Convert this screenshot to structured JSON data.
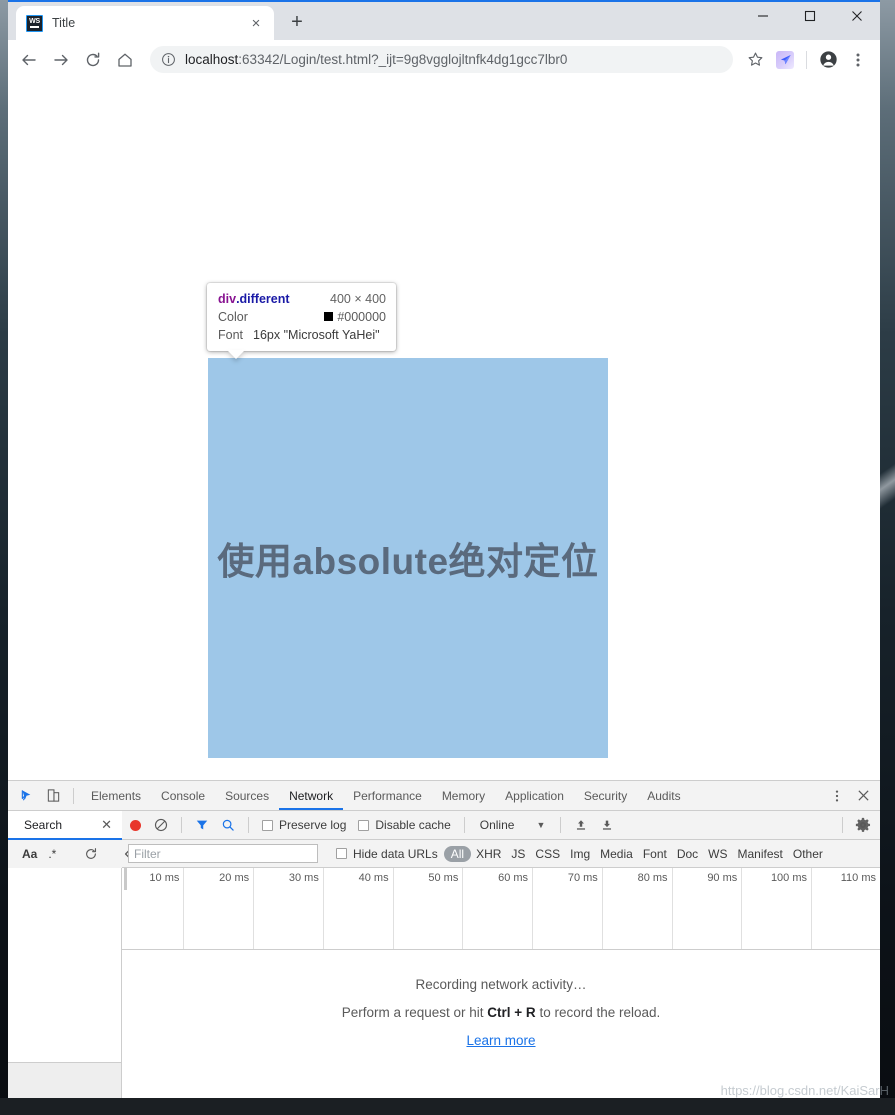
{
  "browser": {
    "tab": {
      "title": "Title",
      "favicon": "webstorm-icon",
      "close_label": "×"
    },
    "new_tab_label": "+",
    "window_controls": {
      "minimize": "minimize-icon",
      "maximize": "maximize-icon",
      "close": "close-icon"
    },
    "nav": {
      "back": "back-arrow-icon",
      "forward": "forward-arrow-icon",
      "reload": "reload-icon",
      "home": "home-icon"
    },
    "omnibox": {
      "info_icon": "info-circle-icon",
      "url_host": "localhost",
      "url_rest": ":63342/Login/test.html?_ijt=9g8vgglojltnfk4dg1gcc7lbr0",
      "url_full": "localhost:63342/Login/test.html?_ijt=9g8vgglojltnfk4dg1gcc7lbr0"
    },
    "actions": {
      "bookmark": "star-icon",
      "extension": "extension-icon",
      "profile": "account-avatar-icon",
      "menu": "three-dot-menu-icon"
    }
  },
  "page": {
    "box_text": "使用absolute绝对定位",
    "box_color": "#9ec7e8",
    "box_text_color": "#5a6a7d"
  },
  "inspect_tooltip": {
    "selector_tag": "div",
    "selector_class": ".different",
    "dimensions": "400 × 400",
    "rows": [
      {
        "label": "Color",
        "value": "#000000",
        "swatch": "#000000"
      },
      {
        "label": "Font",
        "value": "16px \"Microsoft YaHei\""
      }
    ]
  },
  "devtools": {
    "inspect_icon": "inspect-element-icon",
    "device_icon": "device-toolbar-icon",
    "tabs": [
      {
        "label": "Elements",
        "selected": false
      },
      {
        "label": "Console",
        "selected": false
      },
      {
        "label": "Sources",
        "selected": false
      },
      {
        "label": "Network",
        "selected": true
      },
      {
        "label": "Performance",
        "selected": false
      },
      {
        "label": "Memory",
        "selected": false
      },
      {
        "label": "Application",
        "selected": false
      },
      {
        "label": "Security",
        "selected": false
      },
      {
        "label": "Audits",
        "selected": false
      }
    ],
    "more_icon": "three-dot-menu-icon",
    "close_icon": "close-icon",
    "search_panel": {
      "tab_label": "Search",
      "close_label": "✕",
      "match_case": "Aa",
      "regex": ".*",
      "refresh": "refresh-icon",
      "collapse": "chevron-left-icon"
    },
    "network_toolbar": {
      "record_icon": "record-red-dot-icon",
      "clear_icon": "clear-no-entry-icon",
      "filter_icon": "filter-funnel-icon",
      "search_icon": "magnifier-icon",
      "preserve_log_label": "Preserve log",
      "preserve_log_checked": false,
      "disable_cache_label": "Disable cache",
      "disable_cache_checked": false,
      "throttling_value": "Online",
      "throttling_caret": "▼",
      "upload_icon": "import-har-icon",
      "download_icon": "export-har-icon",
      "settings_icon": "gear-icon"
    },
    "filter_row": {
      "filter_placeholder": "Filter",
      "filter_value": "",
      "hide_data_urls_label": "Hide data URLs",
      "hide_data_urls_checked": false,
      "types": [
        "All",
        "XHR",
        "JS",
        "CSS",
        "Img",
        "Media",
        "Font",
        "Doc",
        "WS",
        "Manifest",
        "Other"
      ],
      "active_type": "All"
    },
    "timeline": {
      "ticks": [
        "10 ms",
        "20 ms",
        "30 ms",
        "40 ms",
        "50 ms",
        "60 ms",
        "70 ms",
        "80 ms",
        "90 ms",
        "100 ms",
        "110 ms"
      ]
    },
    "empty_state": {
      "line1": "Recording network activity…",
      "line2_pre": "Perform a request or hit ",
      "line2_key": "Ctrl + R",
      "line2_post": " to record the reload.",
      "link": "Learn more"
    }
  },
  "watermark": {
    "text": "https://blog.csdn.net/KaiSarH"
  }
}
